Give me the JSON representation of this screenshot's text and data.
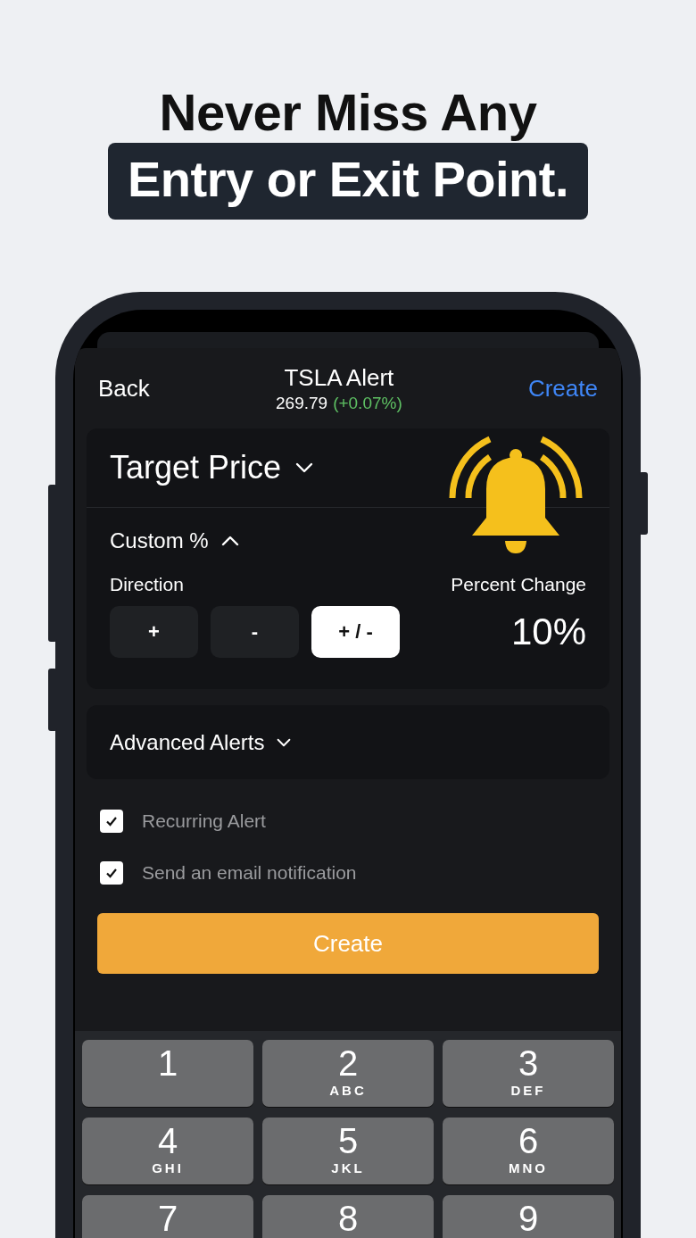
{
  "headline": {
    "line_1": "Never Miss Any",
    "line_2": "Entry or Exit Point."
  },
  "nav": {
    "back": "Back",
    "title": "TSLA Alert",
    "price": "269.79",
    "change": "(+0.07%)",
    "action": "Create"
  },
  "alert_type": {
    "label": "Target Price",
    "expanded": false
  },
  "custom": {
    "label": "Custom %",
    "expanded": true
  },
  "direction": {
    "label": "Direction",
    "options": [
      {
        "label": "+",
        "selected": false
      },
      {
        "label": "-",
        "selected": false
      },
      {
        "label": "+ / -",
        "selected": true
      }
    ]
  },
  "percent_change": {
    "label": "Percent Change",
    "value": "10%"
  },
  "advanced": {
    "label": "Advanced Alerts",
    "expanded": false
  },
  "options": [
    {
      "label": "Recurring Alert",
      "checked": true
    },
    {
      "label": "Send an email notification",
      "checked": true
    }
  ],
  "create_button": "Create",
  "keypad": [
    {
      "digit": "1"
    },
    {
      "digit": "2",
      "letters": "ABC"
    },
    {
      "digit": "3",
      "letters": "DEF"
    },
    {
      "digit": "4",
      "letters": "GHI"
    },
    {
      "digit": "5",
      "letters": "JKL"
    },
    {
      "digit": "6",
      "letters": "MNO"
    },
    {
      "digit": "7"
    },
    {
      "digit": "8"
    },
    {
      "digit": "9"
    }
  ]
}
